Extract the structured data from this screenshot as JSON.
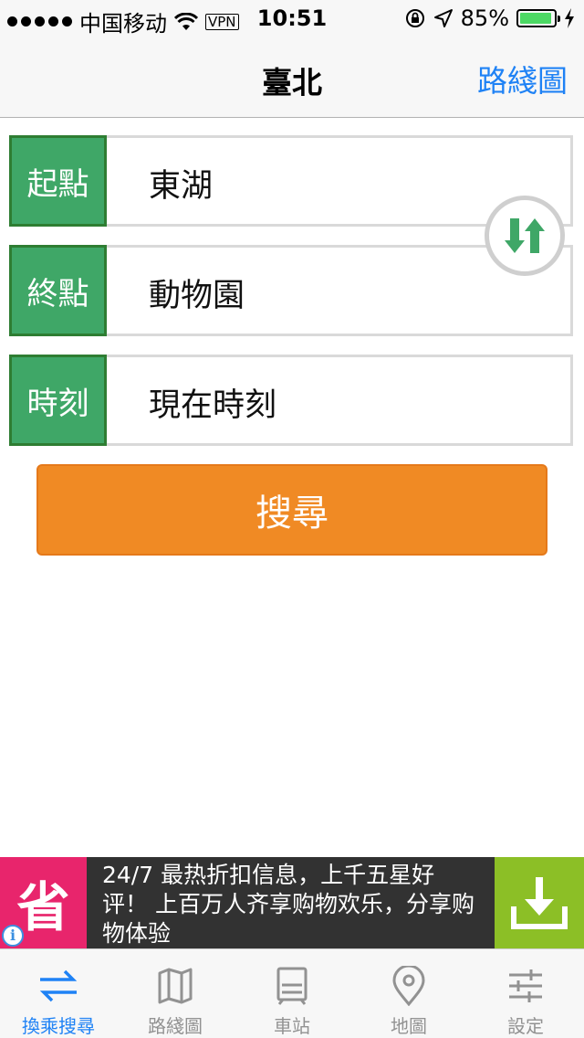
{
  "status_bar": {
    "carrier": "中国移动",
    "vpn": "VPN",
    "time": "10:51",
    "battery": "85%"
  },
  "nav": {
    "title": "臺北",
    "route_map_label": "路綫圖"
  },
  "form": {
    "origin": {
      "label": "起點",
      "value": "東湖"
    },
    "destination": {
      "label": "終點",
      "value": "動物園"
    },
    "time": {
      "label": "時刻",
      "value": "現在時刻"
    },
    "search_label": "搜尋"
  },
  "ad": {
    "logo_char": "省",
    "text": "24/7 最热折扣信息，上千五星好评！ 上百万人齐享购物欢乐，分享购物体验",
    "info": "i"
  },
  "tabs": [
    {
      "label": "換乘搜尋",
      "icon": "transfer-icon",
      "active": true
    },
    {
      "label": "路綫圖",
      "icon": "map-book-icon",
      "active": false
    },
    {
      "label": "車站",
      "icon": "station-icon",
      "active": false
    },
    {
      "label": "地圖",
      "icon": "location-pin-icon",
      "active": false
    },
    {
      "label": "設定",
      "icon": "settings-sliders-icon",
      "active": false
    }
  ],
  "colors": {
    "accent": "#1f82f5",
    "label_green": "#3fa767",
    "search_orange": "#f08a24",
    "ad_pink": "#e8256c",
    "ad_green": "#8cbf26"
  }
}
